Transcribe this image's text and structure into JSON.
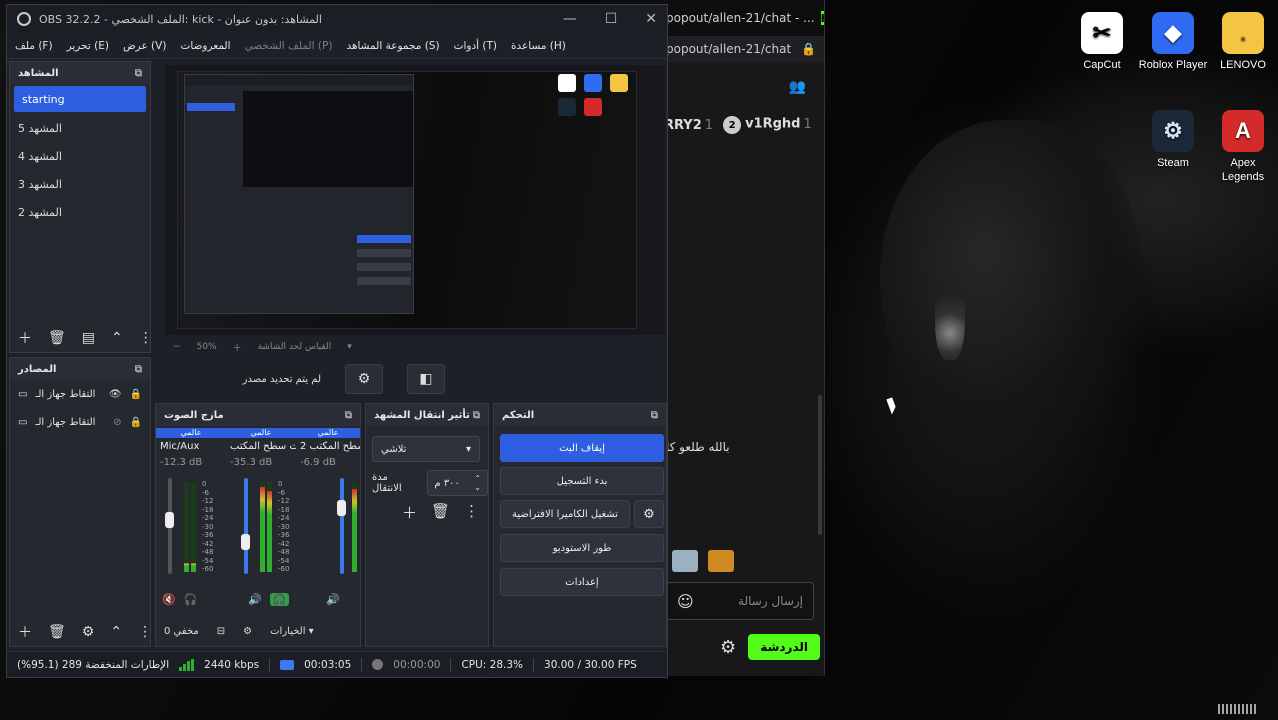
{
  "desktop": {
    "icons": [
      {
        "label": "CapCut",
        "icon": "capcut-icon"
      },
      {
        "label": "Roblox Player",
        "icon": "roblox-icon"
      },
      {
        "label": "LENOVO",
        "icon": "folder-icon"
      },
      {
        "label": "Steam",
        "icon": "steam-icon"
      },
      {
        "label": "Apex\nLegends",
        "icon": "apex-icon"
      }
    ]
  },
  "chat": {
    "title": "popout/allen-21/chat - ...",
    "url": "popout/allen-21/chat",
    "leaderboard": [
      {
        "name": "RRY2",
        "count": "1"
      },
      {
        "rank": "2",
        "name": "v1Rghd",
        "count": "1"
      }
    ],
    "line_mid": "بالله طلعو كا",
    "input_placeholder": "إرسال رسالة",
    "send_label": "الدردشة"
  },
  "obs": {
    "title": "OBS 32.2.2 - الملف الشخصي: kick - المشاهد: بدون عنوان",
    "menu": {
      "file": "ملف (F)",
      "edit": "تحرير (E)",
      "view": "عرض (V)",
      "docks": "المعروضات",
      "profile": "الملف الشخصي (P)",
      "scene_collection": "مجموعة المشاهد (S)",
      "tools": "أدوات (T)",
      "help": "مساعدة (H)"
    },
    "scenes": {
      "title": "المشاهد",
      "items": [
        "starting",
        "المشهد 5",
        "المشهد 4",
        "المشهد 3",
        "المشهد 2"
      ]
    },
    "sources": {
      "title": "المصادر",
      "items": [
        "التقاط جهاز الـ",
        "التقاط جهاز الـ"
      ]
    },
    "preview": {
      "zoom": "50%",
      "zoom_label": "القياس لحد الشاشة"
    },
    "no_source": "لم يتم تحديد مصدر",
    "mixer": {
      "title": "مازج الصوت",
      "channels": [
        {
          "tag": "عالمي",
          "name": "Mic/Aux",
          "db": "-12.3 dB"
        },
        {
          "tag": "عالمي",
          "name": "صوت سطح المكتب",
          "db": "-35.3 dB"
        },
        {
          "tag": "عالمي",
          "name": "سطح المكتب 2",
          "db": "-6.9 dB"
        }
      ],
      "scale": [
        "0",
        "-6",
        "-12",
        "-18",
        "-24",
        "-30",
        "-36",
        "-42",
        "-48",
        "-54",
        "-60"
      ],
      "footer_hidden": "مخفي 0",
      "footer_options": "الخيارات"
    },
    "transitions": {
      "title": "تأثير انتقال المشهد",
      "selected": "تلاشي",
      "duration_label": "مدة الانتقال",
      "duration_value": "٣٠٠ م"
    },
    "controls": {
      "title": "التحكم",
      "stop_stream": "إيقاف البث",
      "start_record": "بدء التسجيل",
      "virtual_cam": "تشغيل الكاميرا الافتراضية",
      "studio_mode": "طور الاستوديو",
      "settings": "إعدادات"
    },
    "status": {
      "dropped": "الإطارات المنخفضة 289 (95.1%)",
      "bitrate": "2440 kbps",
      "live_time": "00:03:05",
      "rec_time": "00:00:00",
      "cpu": "CPU: 28.3%",
      "fps": "30.00 / 30.00 FPS"
    }
  },
  "colors": {
    "accent": "#2e5fe0",
    "kick_green": "#53fc18",
    "meter_green": "#2fae2f"
  }
}
